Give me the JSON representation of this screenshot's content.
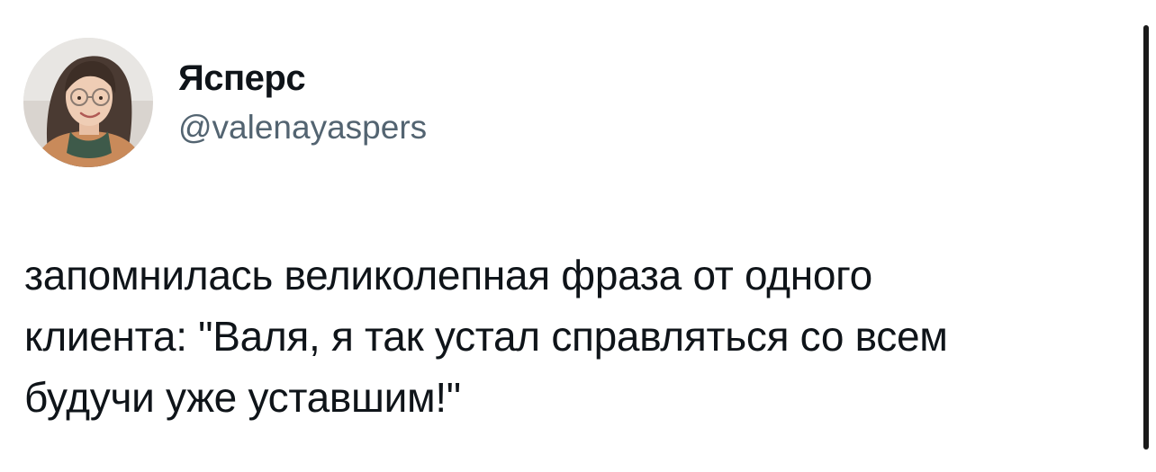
{
  "author": {
    "display_name": "Ясперс",
    "handle": "@valenayaspers",
    "avatar_icon": "profile-photo"
  },
  "tweet": {
    "text": "запомнилась великолепная фраза от одного\nклиента: \"Валя, я так устал справляться со всем\nбудучи уже уставшим!\""
  },
  "colors": {
    "text_primary": "#0f1419",
    "text_secondary": "#536471",
    "background": "#ffffff"
  }
}
